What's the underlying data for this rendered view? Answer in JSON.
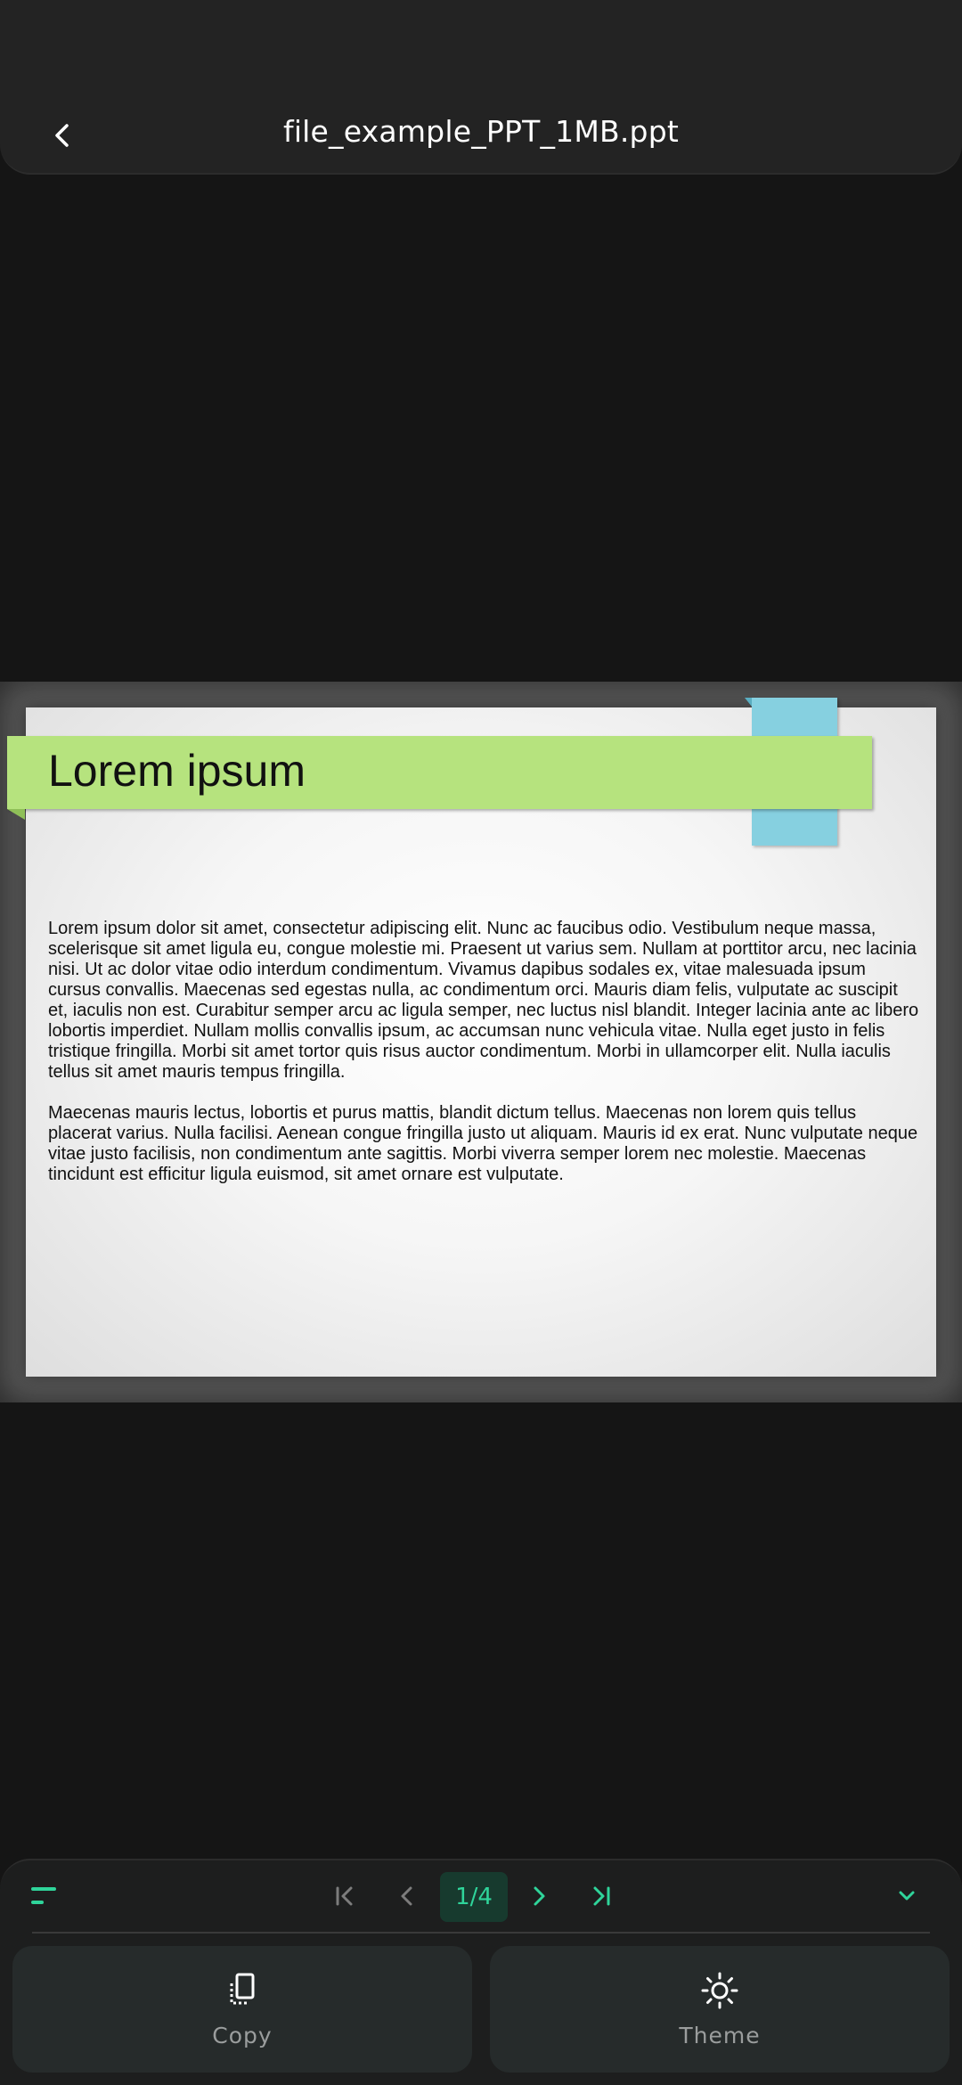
{
  "header": {
    "title": "file_example_PPT_1MB.ppt",
    "back_icon": "chevron-left-icon"
  },
  "slide": {
    "title": "Lorem ipsum",
    "paragraphs": [
      "Lorem ipsum dolor sit amet, consectetur adipiscing elit. Nunc ac faucibus odio. Vestibulum neque massa, scelerisque sit amet ligula eu, congue molestie mi. Praesent ut varius sem. Nullam at porttitor arcu, nec lacinia nisi. Ut ac dolor vitae odio interdum condimentum. Vivamus dapibus sodales ex, vitae malesuada ipsum cursus convallis. Maecenas sed egestas nulla, ac condimentum orci. Mauris diam felis, vulputate ac suscipit et, iaculis non est. Curabitur semper arcu ac ligula semper, nec luctus nisl blandit. Integer lacinia ante ac libero lobortis imperdiet. Nullam mollis convallis ipsum, ac accumsan nunc vehicula vitae. Nulla eget justo in felis tristique fringilla. Morbi sit amet tortor quis risus auctor condimentum. Morbi in ullamcorper elit. Nulla iaculis tellus sit amet mauris tempus fringilla.",
      "Maecenas mauris lectus, lobortis et purus mattis, blandit dictum tellus. Maecenas non lorem quis tellus placerat varius. Nulla facilisi. Aenean congue fringilla justo ut aliquam. Mauris id ex erat. Nunc vulputate neque vitae justo facilisis, non condimentum ante sagittis. Morbi viverra semper lorem nec molestie. Maecenas tincidunt est efficitur ligula euismod, sit amet ornare est vulputate."
    ],
    "colors": {
      "banner": "#b6e37e",
      "ribbon": "#86d0e0"
    }
  },
  "navigation": {
    "page_indicator": "1/4",
    "icons": [
      "menu-icon",
      "first-page-icon",
      "previous-page-icon",
      "next-page-icon",
      "last-page-icon",
      "chevron-down-icon"
    ]
  },
  "actions": [
    {
      "label": "Copy",
      "icon": "copy-icon"
    },
    {
      "label": "Theme",
      "icon": "brightness-icon"
    }
  ],
  "colors": {
    "accent": "#2fd49a",
    "disabled": "#7c7c7c",
    "background": "#151515"
  }
}
